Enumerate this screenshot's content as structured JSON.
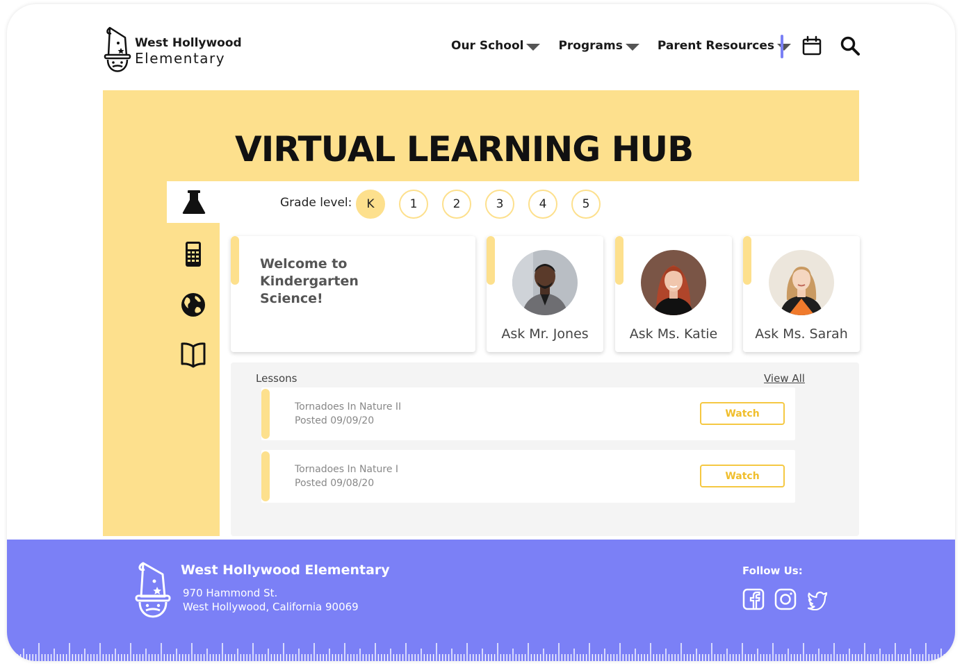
{
  "header": {
    "logo_line1": "West Hollywood",
    "logo_line2": "Elementary",
    "nav": [
      {
        "label": "Our School"
      },
      {
        "label": "Programs"
      },
      {
        "label": "Parent Resources"
      }
    ]
  },
  "hero": {
    "title": "VIRTUAL LEARNING HUB"
  },
  "sidebar": {
    "tabs": [
      {
        "icon": "flask-icon",
        "active": true
      },
      {
        "icon": "calculator-icon",
        "active": false
      },
      {
        "icon": "globe-icon",
        "active": false
      },
      {
        "icon": "book-icon",
        "active": false
      }
    ]
  },
  "grades": {
    "label": "Grade level:",
    "options": [
      "K",
      "1",
      "2",
      "3",
      "4",
      "5"
    ],
    "selected": "K"
  },
  "welcome": {
    "text": "Welcome to Kindergarten Science!"
  },
  "teachers": [
    {
      "label": "Ask Mr. Jones"
    },
    {
      "label": "Ask Ms. Katie"
    },
    {
      "label": "Ask Ms. Sarah"
    }
  ],
  "lessons": {
    "title": "Lessons",
    "view_all": "View All",
    "items": [
      {
        "title": "Tornadoes In Nature II",
        "date": "Posted 09/09/20",
        "button": "Watch"
      },
      {
        "title": "Tornadoes In Nature I",
        "date": "Posted 09/08/20",
        "button": "Watch"
      }
    ]
  },
  "footer": {
    "name": "West Hollywood Elementary",
    "address1": "970 Hammond St.",
    "address2": "West Hollywood, California 90069",
    "follow": "Follow Us:",
    "social": [
      "facebook-icon",
      "instagram-icon",
      "twitter-icon"
    ]
  },
  "colors": {
    "accent_yellow": "#fde08d",
    "accent_purple": "#7b80f6",
    "watch_border": "#f5c842"
  }
}
